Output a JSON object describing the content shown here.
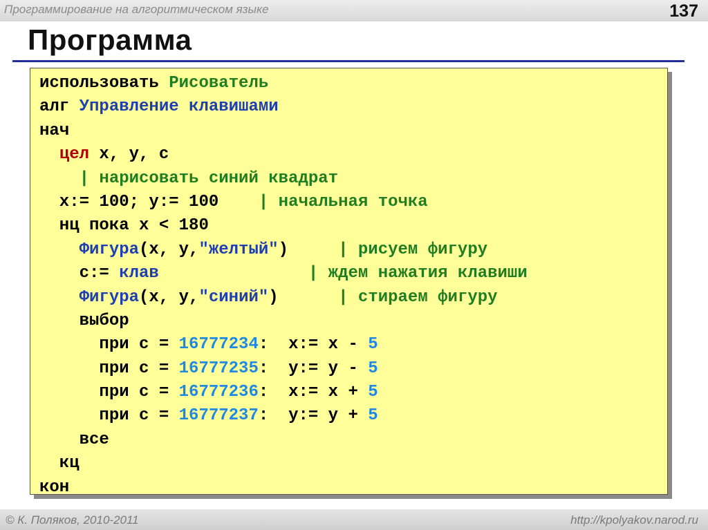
{
  "header": {
    "course": "Программирование на алгоритмическом языке",
    "page": "137",
    "title": "Программа"
  },
  "code": [
    [
      {
        "t": "использовать ",
        "c": "kw"
      },
      {
        "t": "Рисователь",
        "c": "gr"
      }
    ],
    [
      {
        "t": "алг ",
        "c": "kw"
      },
      {
        "t": "Управление клавишами",
        "c": "bl"
      }
    ],
    [
      {
        "t": "нач",
        "c": "kw"
      }
    ],
    [
      {
        "t": "  ",
        "c": "kw"
      },
      {
        "t": "цел",
        "c": "kr"
      },
      {
        "t": " x, y, c",
        "c": "kw"
      }
    ],
    [
      {
        "t": "    ",
        "c": "kw"
      },
      {
        "t": "| нарисовать синий квадрат",
        "c": "cm"
      }
    ],
    [
      {
        "t": "  x:= 100; y:= 100    ",
        "c": "kw"
      },
      {
        "t": "| начальная точка",
        "c": "cm"
      }
    ],
    [
      {
        "t": "  нц пока x < 180",
        "c": "kw"
      }
    ],
    [
      {
        "t": "    ",
        "c": "kw"
      },
      {
        "t": "Фигура",
        "c": "bl"
      },
      {
        "t": "(x, y,",
        "c": "kw"
      },
      {
        "t": "\"желтый\"",
        "c": "bl"
      },
      {
        "t": ")     ",
        "c": "kw"
      },
      {
        "t": "| рисуем фигуру",
        "c": "cm"
      }
    ],
    [
      {
        "t": "    c:= ",
        "c": "kw"
      },
      {
        "t": "клав",
        "c": "bl"
      },
      {
        "t": "               ",
        "c": "kw"
      },
      {
        "t": "| ждем нажатия клавиши",
        "c": "cm"
      }
    ],
    [
      {
        "t": "    ",
        "c": "kw"
      },
      {
        "t": "Фигура",
        "c": "bl"
      },
      {
        "t": "(x, y,",
        "c": "kw"
      },
      {
        "t": "\"синий\"",
        "c": "bl"
      },
      {
        "t": ")      ",
        "c": "kw"
      },
      {
        "t": "| стираем фигуру",
        "c": "cm"
      }
    ],
    [
      {
        "t": "    выбор",
        "c": "kw"
      }
    ],
    [
      {
        "t": "      при c = ",
        "c": "kw"
      },
      {
        "t": "16777234",
        "c": "cy"
      },
      {
        "t": ":  x:= x - ",
        "c": "kw"
      },
      {
        "t": "5",
        "c": "cy"
      }
    ],
    [
      {
        "t": "      при c = ",
        "c": "kw"
      },
      {
        "t": "16777235",
        "c": "cy"
      },
      {
        "t": ":  y:= y - ",
        "c": "kw"
      },
      {
        "t": "5",
        "c": "cy"
      }
    ],
    [
      {
        "t": "      при c = ",
        "c": "kw"
      },
      {
        "t": "16777236",
        "c": "cy"
      },
      {
        "t": ":  x:= x + ",
        "c": "kw"
      },
      {
        "t": "5",
        "c": "cy"
      }
    ],
    [
      {
        "t": "      при c = ",
        "c": "kw"
      },
      {
        "t": "16777237",
        "c": "cy"
      },
      {
        "t": ":  y:= y + ",
        "c": "kw"
      },
      {
        "t": "5",
        "c": "cy"
      }
    ],
    [
      {
        "t": "    все",
        "c": "kw"
      }
    ],
    [
      {
        "t": "  кц",
        "c": "kw"
      }
    ],
    [
      {
        "t": "кон",
        "c": "kw"
      }
    ]
  ],
  "footer": {
    "author": "© К. Поляков, 2010-2011",
    "site": "http://kpolyakov.narod.ru"
  }
}
